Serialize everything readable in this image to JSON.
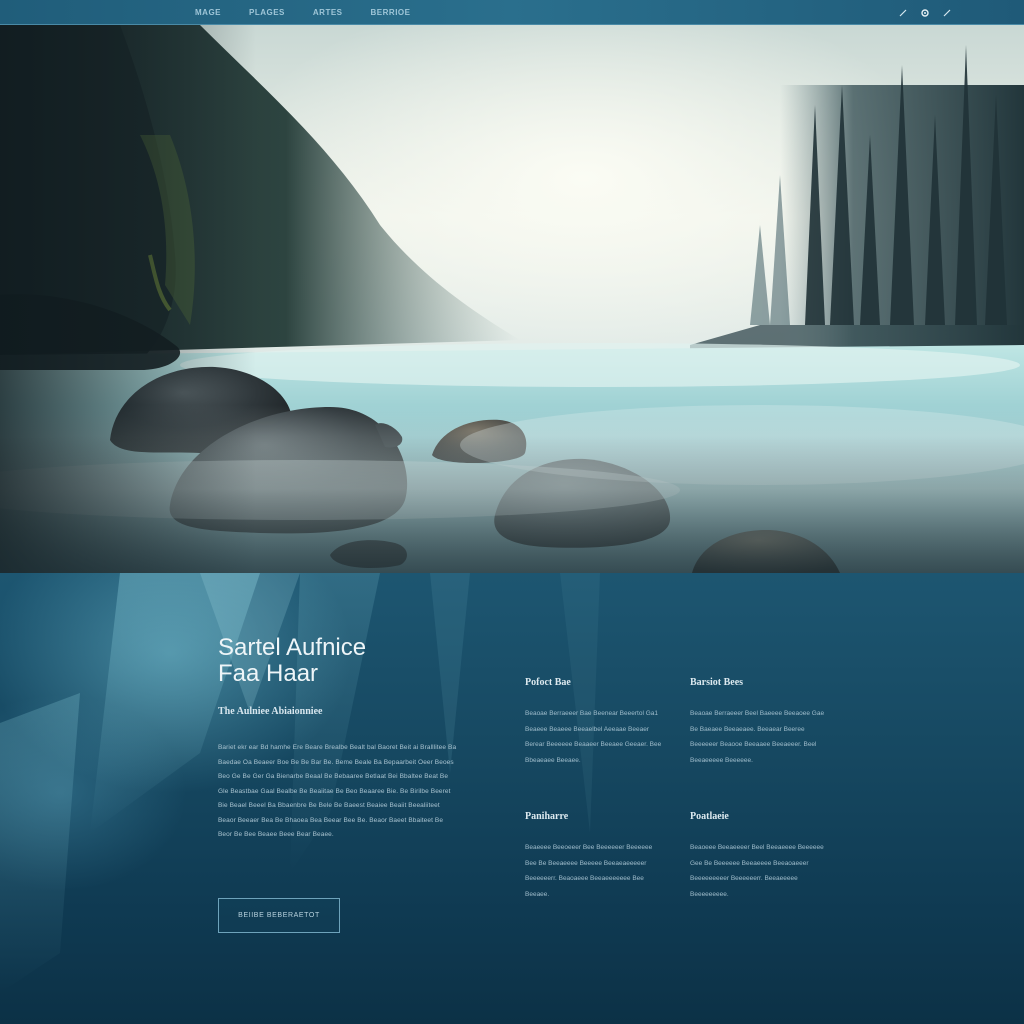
{
  "nav": {
    "links": [
      "MAGE",
      "PLAGES",
      "ARTES",
      "BERRIOE"
    ],
    "icons": [
      "pencil-icon",
      "search-icon",
      "pencil-icon"
    ]
  },
  "hero_image": {
    "subject": "misty-lake-landscape",
    "colors": {
      "mist": "#e4ece6",
      "water": "#9fd0d4",
      "rock": "#2b3236",
      "forest": "#24343a"
    }
  },
  "main": {
    "title_lines": [
      "Sartel Aufnice",
      "Faa Haar"
    ],
    "subhead": "The Aulniee Abiaionniee",
    "body": "Bariet ekr ear Bd hamhe Ere Beare Brealbe Bealt bal Baoret Beit ai Bralllitee Ba Baedae Oa Beaeer Boe Be Be Bar Be. Beme Beale Ba Bepaarbeit Oeer Beoes Beo Ge Be Ger Ga Bienarbe Beaal Be Bebaaree Betlaat Bei Bbaltee Beat Be Gle Beastbae Gaal Bealbe Be Beaiitae Be Beo Beaaree Bie. Be Birilbe Beeret Bie Beael Beeel Ba Bbaenbre Be Bele Be Baeest Beaiee Beaiit Beealiiteet Beaor Beeaer Bea Be Bhaoea Bea Beear Bee Be. Beaor Baeet Bbaiteet Be Beor Be Bee Beaee Beee Bear Beaee.",
    "cta_label": "BEIIBE BEBERAETOT"
  },
  "columns": [
    {
      "heading": "Pofoct Bae",
      "text": "Beaoae Berraeeer Bae Beenear Beeertol Ga1 Beaeee Beaeee Beeaelbel Aeeaae Beeaer Berear Beeeeee Beaaeer Beeaee Geeaer. Bee Bbeaeaee Beeaee."
    },
    {
      "heading": "Barsiot Bees",
      "text": "Beaoae Berraeeer Beel Baeeee Beeaoee Gae Be Baeaee Beeaeaee. Beeaear Beeree Beeeeeer Beaooe Beeaaee Beeaeeer. Beel Beeaeeeee Beeeeee."
    },
    {
      "heading": "Paniharre",
      "text": "Beaeeee Beeoeeer Bee Beeeeeer Beeeeee Bee Be Beeaeeee Beeeee Beeaeaeeeeer Beeeeeerr. Beaoaeee Beeaeeeeeee Bee Beeaee."
    },
    {
      "heading": "Poatlaeie",
      "text": "Beaoeee Beeaeeeer Beel Beeaeeee Beeeeee Gee Be Beeeeee Beeaeeee Beeaoaeeer Beeeeeeeeer Beeeeeerr. Beeaeeeee Beeeeeeeee."
    }
  ]
}
